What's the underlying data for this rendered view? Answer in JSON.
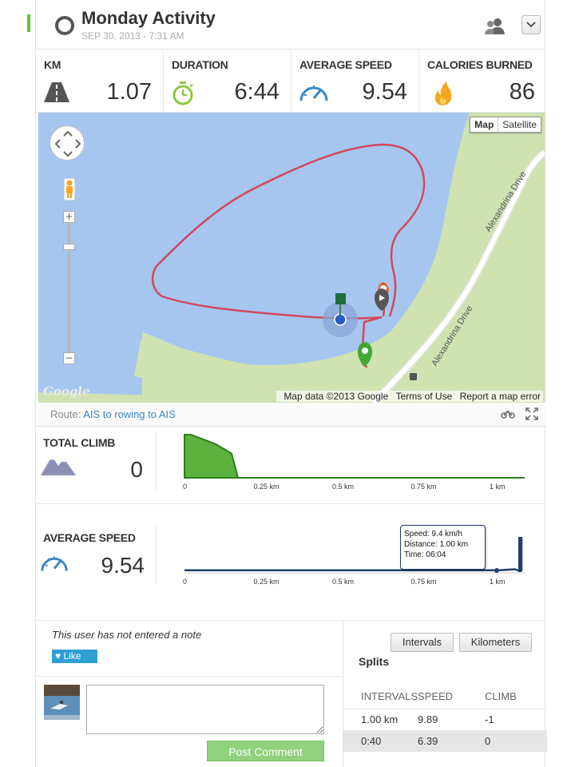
{
  "header": {
    "title": "Monday Activity",
    "subtitle": "SEP 30, 2013  -  7:31 AM"
  },
  "stats": [
    {
      "label": "KM",
      "value": "1.07",
      "icon": "road-icon"
    },
    {
      "label": "DURATION",
      "value": "6:44",
      "icon": "stopwatch-icon"
    },
    {
      "label": "AVERAGE SPEED",
      "value": "9.54",
      "icon": "speedometer-icon"
    },
    {
      "label": "CALORIES BURNED",
      "value": "86",
      "icon": "flame-icon"
    }
  ],
  "map": {
    "type_map": "Map",
    "type_satellite": "Satellite",
    "road_label": "Alexandrina Drive",
    "road_label_2": "Alexandrina Drive",
    "marker_label": "1",
    "zoom_in": "+",
    "zoom_out": "−",
    "logo": "Google",
    "attribution": {
      "data": "Map data ©2013 Google",
      "terms": "Terms of Use",
      "report": "Report a map error"
    },
    "colors": {
      "water": "#a3c3ef",
      "land": "#cfe2b0",
      "route": "#d1495b",
      "road": "#ffffff"
    }
  },
  "route": {
    "label": "Route:",
    "link": "AIS to rowing to AIS"
  },
  "climb": {
    "label": "TOTAL CLIMB",
    "value": "0",
    "ticks": [
      "0",
      "0.25 km",
      "0.5 km",
      "0.75 km",
      "1 km"
    ]
  },
  "speed": {
    "label": "AVERAGE SPEED",
    "value": "9.54",
    "ticks": [
      "0",
      "0.25 km",
      "0.5 km",
      "0.75 km",
      "1 km"
    ],
    "tooltip": {
      "speed": "Speed: 9.4 km/h",
      "distance": "Distance: 1.00 km",
      "time": "Time: 06:04"
    }
  },
  "chart_data": [
    {
      "type": "area",
      "x": [
        0,
        0.02,
        0.1,
        0.15,
        0.17,
        1.0,
        1.15
      ],
      "y": [
        1,
        1,
        0.78,
        0.56,
        0,
        0,
        0
      ],
      "xlabel": "",
      "ylabel": "",
      "color": "#5cb23f"
    },
    {
      "type": "line",
      "x": [
        0,
        0.1,
        0.25,
        0.5,
        0.75,
        1.0,
        1.05,
        1.06,
        1.08,
        1.1
      ],
      "y": [
        0.05,
        0.05,
        0.05,
        0.05,
        0.05,
        0.05,
        0.08,
        0.05,
        0.05,
        1
      ],
      "xlabel": "",
      "ylabel": "",
      "color": "#1e3f6e"
    }
  ],
  "note": {
    "text": "This user has not entered a note",
    "like": "Like"
  },
  "comment": {
    "placeholder": "",
    "post": "Post Comment"
  },
  "splits": {
    "tab_intervals": "Intervals",
    "tab_kilometers": "Kilometers",
    "title": "Splits",
    "columns": [
      "INTERVALS",
      "SPEED",
      "CLIMB"
    ],
    "rows": [
      [
        "1.00 km",
        "9.89",
        "-1"
      ],
      [
        "0:40",
        "6.39",
        "0"
      ]
    ]
  }
}
